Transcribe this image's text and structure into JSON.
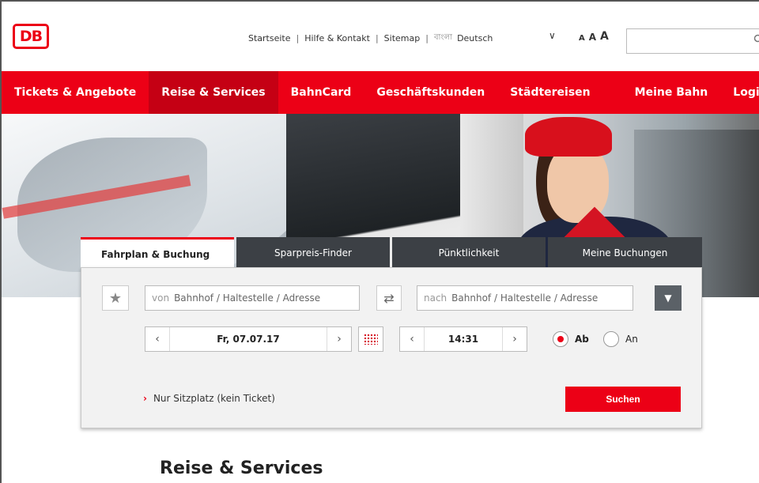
{
  "header": {
    "logo_text": "DB",
    "meta_nav": [
      "Startseite",
      "Hilfe & Kontakt",
      "Sitemap"
    ],
    "language_glyph": "বাংলা",
    "language": "Deutsch",
    "font_sizes": [
      "A",
      "A",
      "A"
    ],
    "search_placeholder": ""
  },
  "main_nav": {
    "items": [
      "Tickets & Angebote",
      "Reise & Services",
      "BahnCard",
      "Geschäftskunden",
      "Städtereisen",
      "Meine Bahn",
      "Login"
    ],
    "active_index": 1
  },
  "booking": {
    "tabs": [
      "Fahrplan & Buchung",
      "Sparpreis-Finder",
      "Pünktlichkeit",
      "Meine Buchungen"
    ],
    "from_prefix": "von",
    "from_placeholder": "Bahnhof / Haltestelle / Adresse",
    "to_prefix": "nach",
    "to_placeholder": "Bahnhof / Haltestelle / Adresse",
    "date": "Fr, 07.07.17",
    "time": "14:31",
    "radio_ab": "Ab",
    "radio_an": "An",
    "selected_radio": "Ab",
    "seat_link": "Nur Sitzplatz (kein Ticket)",
    "search_button": "Suchen"
  },
  "section_title": "Reise & Services",
  "colors": {
    "brand_red": "#ec0016",
    "nav_active": "#c50014",
    "tab_dark": "#3c4045"
  },
  "icons": {
    "favorite": "star-icon",
    "swap": "swap-arrows-icon",
    "dropdown": "chevron-down-icon",
    "calendar": "calendar-icon",
    "search": "search-icon"
  }
}
